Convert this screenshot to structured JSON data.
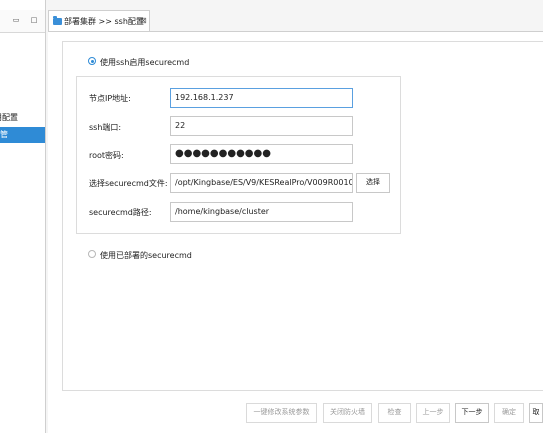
{
  "left_panel": {
    "controls": {
      "minimize": "▭",
      "maximize": "□"
    },
    "items": [
      {
        "label": "用配置",
        "selected": false
      },
      {
        "label": "管",
        "selected": true
      }
    ]
  },
  "editor_tab": {
    "icon": "folder-icon",
    "title": "部署集群 >> ssh配置",
    "close_glyph": "⊠"
  },
  "options": {
    "use_ssh": "使用ssh启用securecmd",
    "use_deployed": "使用已部署的securecmd"
  },
  "form": {
    "node_ip": {
      "label": "节点IP地址:",
      "value": "192.168.1.237"
    },
    "ssh_port": {
      "label": "ssh端口:",
      "value": "22"
    },
    "root_password": {
      "label": "root密码:",
      "value": "●●●●●●●●●●●"
    },
    "securecmd_file": {
      "label": "选择securecmd文件:",
      "value": "/opt/Kingbase/ES/V9/KESRealPro/V009R001C0",
      "browse_label": "选择"
    },
    "securecmd_path": {
      "label": "securecmd路径:",
      "value": "/home/kingbase/cluster"
    }
  },
  "buttons": {
    "modify_params": "一键修改系统参数",
    "close_firewall": "关闭防火墙",
    "check": "检查",
    "prev": "上一步",
    "next": "下一步",
    "ok": "确定",
    "cancel": "取"
  },
  "colors": {
    "accent": "#2f8bd6",
    "focus_border": "#5aa0e0"
  }
}
